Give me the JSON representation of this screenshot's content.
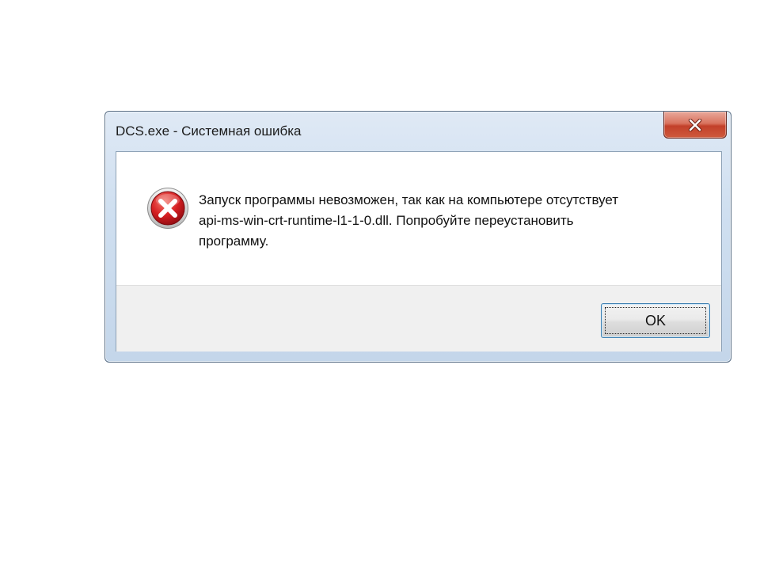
{
  "window": {
    "title": "DCS.exe - Системная ошибка"
  },
  "titlebar": {
    "close_icon": "close-icon"
  },
  "message": {
    "icon": "error-icon",
    "lines": [
      "Запуск программы невозможен, так как на компьютере отсутствует",
      "api-ms-win-crt-runtime-l1-1-0.dll. Попробуйте переустановить",
      "программу."
    ]
  },
  "buttons": {
    "ok_label": "OK"
  },
  "colors": {
    "close_button": "#c2402a",
    "error_icon": "#c8141c",
    "button_focus_border": "#3c7fb1"
  }
}
